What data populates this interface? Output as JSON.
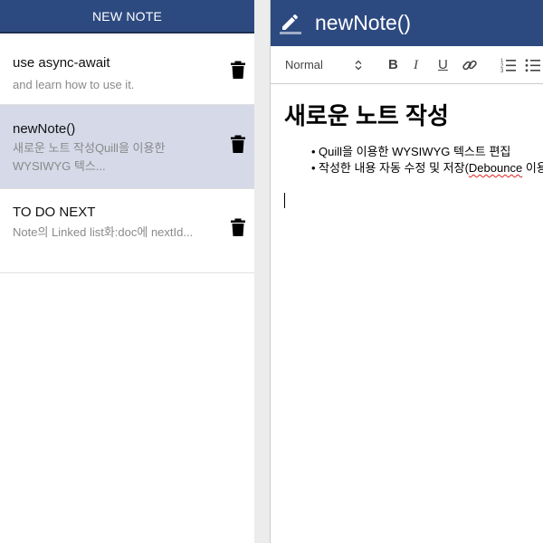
{
  "sidebar": {
    "new_note_label": "NEW NOTE",
    "notes": [
      {
        "title": "use async-await",
        "preview": "and learn how to use it.",
        "selected": false
      },
      {
        "title": "newNote()",
        "preview": "새로운 노트 작성Quill을 이용한 WYSIWYG 텍스...",
        "selected": true
      },
      {
        "title": "TO DO NEXT",
        "preview": "Note의 Linked list화:doc에 nextId...",
        "selected": false
      }
    ],
    "delete_icon": "trash-icon"
  },
  "editor": {
    "title": "newNote()",
    "title_icon": "pencil-icon",
    "toolbar": {
      "format_select_value": "Normal",
      "bold_label": "B",
      "italic_label": "I",
      "underline_label": "U",
      "link_icon": "link-icon",
      "ordered_list_icon": "ordered-list-icon",
      "bullet_list_icon": "bullet-list-icon"
    },
    "content": {
      "heading": "새로운 노트 작성",
      "bullets": [
        {
          "pre": "Quill을 이용한 WYSIWYG 텍스트 편집",
          "err": "",
          "post": ""
        },
        {
          "pre": "작성한 내용 자동 수정 및 저장(",
          "err": "Debounce",
          "post": " 이용"
        }
      ]
    }
  },
  "colors": {
    "brand": "#2d4a80",
    "selected_row": "#d5d9e8",
    "preview_text": "#8a8a8a"
  }
}
